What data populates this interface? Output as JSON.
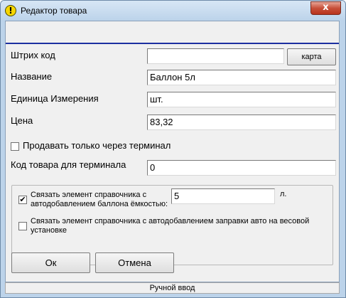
{
  "window": {
    "title": "Редактор товара",
    "close_glyph": "x",
    "title_icon_glyph": "!"
  },
  "form": {
    "barcode_label": "Штрих код",
    "barcode_value": "",
    "card_button": "карта",
    "name_label": "Название",
    "name_value": "Баллон 5л",
    "unit_label": "Единица Измерения",
    "unit_value": "шт.",
    "price_label": "Цена",
    "price_value": "83,32",
    "terminal_only_label": "Продавать только через терминал",
    "terminal_only_checked": false,
    "terminal_code_label": "Код товара для терминала",
    "terminal_code_value": "0"
  },
  "group": {
    "link_cylinder_label_1": "Связать элемент справочника с",
    "link_cylinder_label_2": "автодобавлением баллона ёмкостью:",
    "link_cylinder_checked": true,
    "cylinder_capacity_value": "5",
    "capacity_unit": "л.",
    "link_refuel_label_1": "Связать элемент справочника с автодобавлением заправки авто на весовой",
    "link_refuel_label_2": "установке",
    "link_refuel_checked": false
  },
  "buttons": {
    "ok": "Ок",
    "cancel": "Отмена"
  },
  "status": {
    "mode": "Ручной ввод"
  }
}
